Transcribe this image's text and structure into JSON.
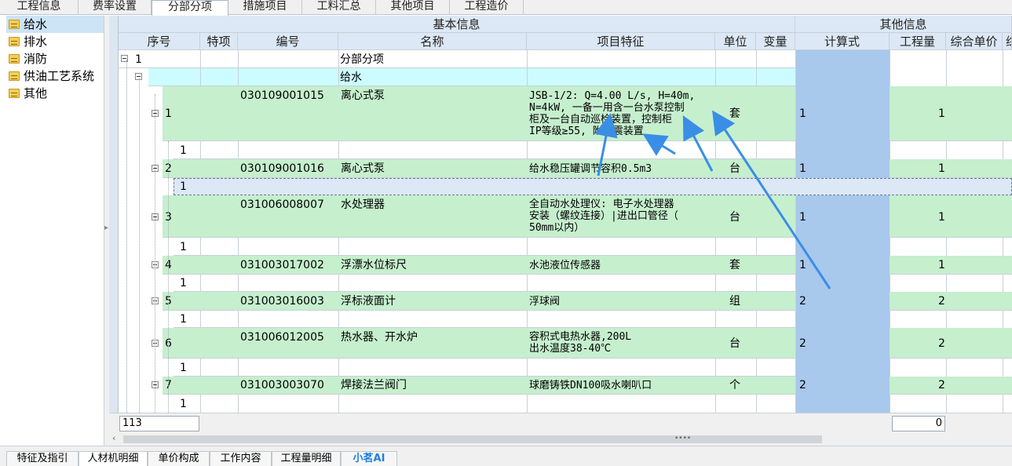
{
  "tabs": [
    "工程信息",
    "费率设置",
    "分部分项",
    "措施项目",
    "工料汇总",
    "其他项目",
    "工程造价"
  ],
  "active_tab": "分部分项",
  "sidebar": [
    {
      "label": "给水"
    },
    {
      "label": "排水"
    },
    {
      "label": "消防"
    },
    {
      "label": "供油工艺系统"
    },
    {
      "label": "其他"
    }
  ],
  "headers": {
    "group_basic": "基本信息",
    "group_other": "其他信息",
    "seq": "序号",
    "special": "特项",
    "code": "编号",
    "name": "名称",
    "feature": "项目特征",
    "unit": "单位",
    "variable": "变量",
    "formula": "计算式",
    "quantity": "工程量",
    "unit_price": "综合单价",
    "extra": "综"
  },
  "rows": {
    "r1": {
      "seq": "1",
      "name": "分部分项"
    },
    "r2": {
      "name": "给水"
    },
    "i1": {
      "seq": "1",
      "code": "030109001015",
      "name": "离心式泵",
      "feature": "JSB-1/2: Q=4.00 L/s, H=40m,\nN=4kW, 一备一用含一台水泵控制\n柜及一台自动巡检装置，控制柜\nIP等级≥55, 附减震装置",
      "unit": "套",
      "formula": "1",
      "qty": "1"
    },
    "i1s": {
      "seq": "1"
    },
    "i2": {
      "seq": "2",
      "code": "030109001016",
      "name": "离心式泵",
      "feature": "给水稳压罐调节容积0.5m3",
      "unit": "台",
      "formula": "1",
      "qty": "1"
    },
    "i2s": {
      "seq": "1"
    },
    "i3": {
      "seq": "3",
      "code": "031006008007",
      "name": "水处理器",
      "feature": "全自动水处理仪: 电子水处理器\n安装（螺纹连接）|进出口管径（\n50mm以内）",
      "unit": "台",
      "formula": "1",
      "qty": "1"
    },
    "i3s": {
      "seq": "1"
    },
    "i4": {
      "seq": "4",
      "code": "031003017002",
      "name": "浮漂水位标尺",
      "feature": "水池液位传感器",
      "unit": "套",
      "formula": "1",
      "qty": "1"
    },
    "i4s": {
      "seq": "1"
    },
    "i5": {
      "seq": "5",
      "code": "031003016003",
      "name": "浮标液面计",
      "feature": "浮球阀",
      "unit": "组",
      "formula": "2",
      "qty": "2"
    },
    "i5s": {
      "seq": "1"
    },
    "i6": {
      "seq": "6",
      "code": "031006012005",
      "name": "热水器、开水炉",
      "feature": "容积式电热水器,200L\n出水温度38-40℃",
      "unit": "台",
      "formula": "2",
      "qty": "2"
    },
    "i6s": {
      "seq": "1"
    },
    "i7": {
      "seq": "7",
      "code": "031003003070",
      "name": "焊接法兰阀门",
      "feature": "球磨铸铁DN100吸水喇叭口",
      "unit": "个",
      "formula": "2",
      "qty": "2"
    },
    "i7s": {
      "seq": "1"
    }
  },
  "footer": {
    "count": "113",
    "total": "0"
  },
  "bottom_tabs": [
    "特征及指引",
    "人材机明细",
    "单价构成",
    "工作内容",
    "工程量明细",
    "小茗AI"
  ],
  "bottom_active": "人材机明细",
  "colors": {
    "green_row": "#c6efce",
    "cyan_row": "#ccfcff",
    "formula_col": "#a8c8ec",
    "header": "#dce8f5",
    "arrow": "#3a8ee6",
    "ai_text": "#1e7fe0"
  }
}
